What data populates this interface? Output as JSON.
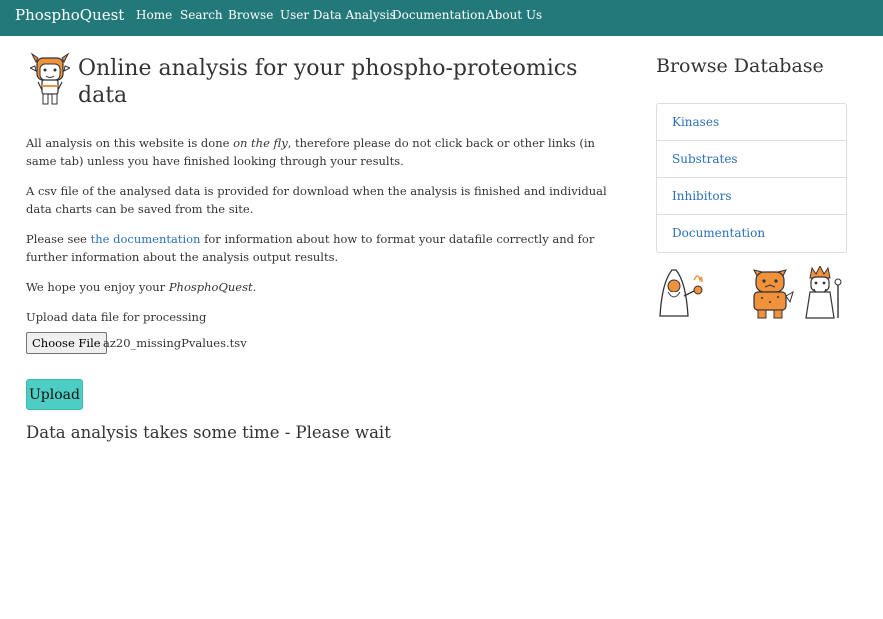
{
  "navbar": {
    "brand": "PhosphoQuest",
    "links": [
      "Home",
      "Search",
      "Browse",
      "User Data Analysis",
      "Documentation",
      "About Us"
    ]
  },
  "main": {
    "title": "Online analysis for your phospho-proteomics data",
    "p1": {
      "before": "All analysis on this website is done ",
      "em": "on the fly",
      "after": ", therefore please do not click back or other links (in same tab) unless you have finished looking through your results."
    },
    "p2": "A csv file of the analysed data is provided for download when the analysis is finished and individual data charts can be saved from the site.",
    "p3": {
      "before": "Please see ",
      "link": "the documentation",
      "after": " for information about how to format your datafile correctly and for further information about the analysis output results."
    },
    "p4": {
      "before": "We hope you enjoy your ",
      "em": "PhosphoQuest",
      "after": "."
    },
    "upload_label": "Upload data file for processing",
    "choose_file_label": "Choose File",
    "selected_file": "az20_missingPvalues.tsv",
    "upload_button": "Upload",
    "wait_message": "Data analysis takes some time - Please wait"
  },
  "sidebar": {
    "title": "Browse Database",
    "items": [
      "Kinases",
      "Substrates",
      "Inhibitors",
      "Documentation"
    ]
  },
  "icons": {
    "header": "goat-character-icon",
    "sidebar": [
      "wizard-character-icon",
      "warrior-character-icon",
      "sage-character-icon"
    ]
  },
  "colors": {
    "navbar": "#23787a",
    "link": "#2a6fb8",
    "upload_button": "#4ecdc4",
    "accent_orange": "#f0923c"
  }
}
